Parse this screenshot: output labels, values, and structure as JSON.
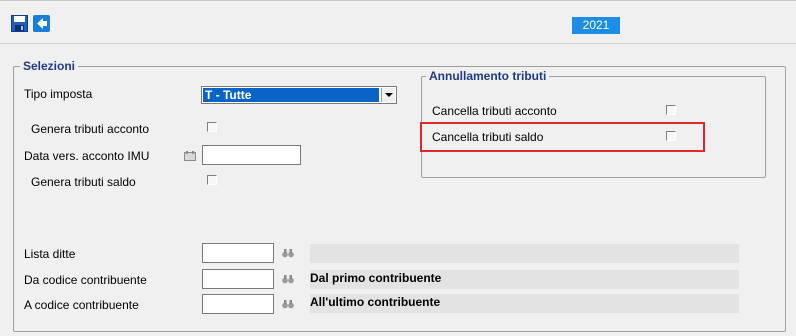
{
  "toolbar": {
    "save_icon": "save-icon",
    "back_icon": "back-arrow-icon",
    "year": "2021"
  },
  "selezioni": {
    "legend": "Selezioni",
    "tipo_imposta_label": "Tipo imposta",
    "tipo_imposta_value": "T - Tutte",
    "genera_acconto_label": "Genera tributi acconto",
    "genera_acconto_checked": false,
    "data_vers_label": "Data vers. acconto IMU",
    "data_vers_value": "",
    "genera_saldo_label": "Genera tributi saldo",
    "genera_saldo_checked": false
  },
  "annullamento": {
    "legend": "Annullamento tributi",
    "cancella_acconto_label": "Cancella tributi acconto",
    "cancella_acconto_checked": false,
    "cancella_saldo_label": "Cancella tributi saldo",
    "cancella_saldo_checked": false
  },
  "ricerca": {
    "lista_ditte_label": "Lista ditte",
    "lista_ditte_value": "",
    "lista_ditte_desc": "",
    "da_codice_label": "Da codice contribuente",
    "da_codice_value": "",
    "da_codice_desc": "Dal primo contribuente",
    "a_codice_label": "A codice contribuente",
    "a_codice_value": "",
    "a_codice_desc": "All'ultimo contribuente"
  },
  "colors": {
    "accent": "#1c8ee6",
    "highlight": "#e0282e",
    "legend": "#1f3a8a"
  }
}
